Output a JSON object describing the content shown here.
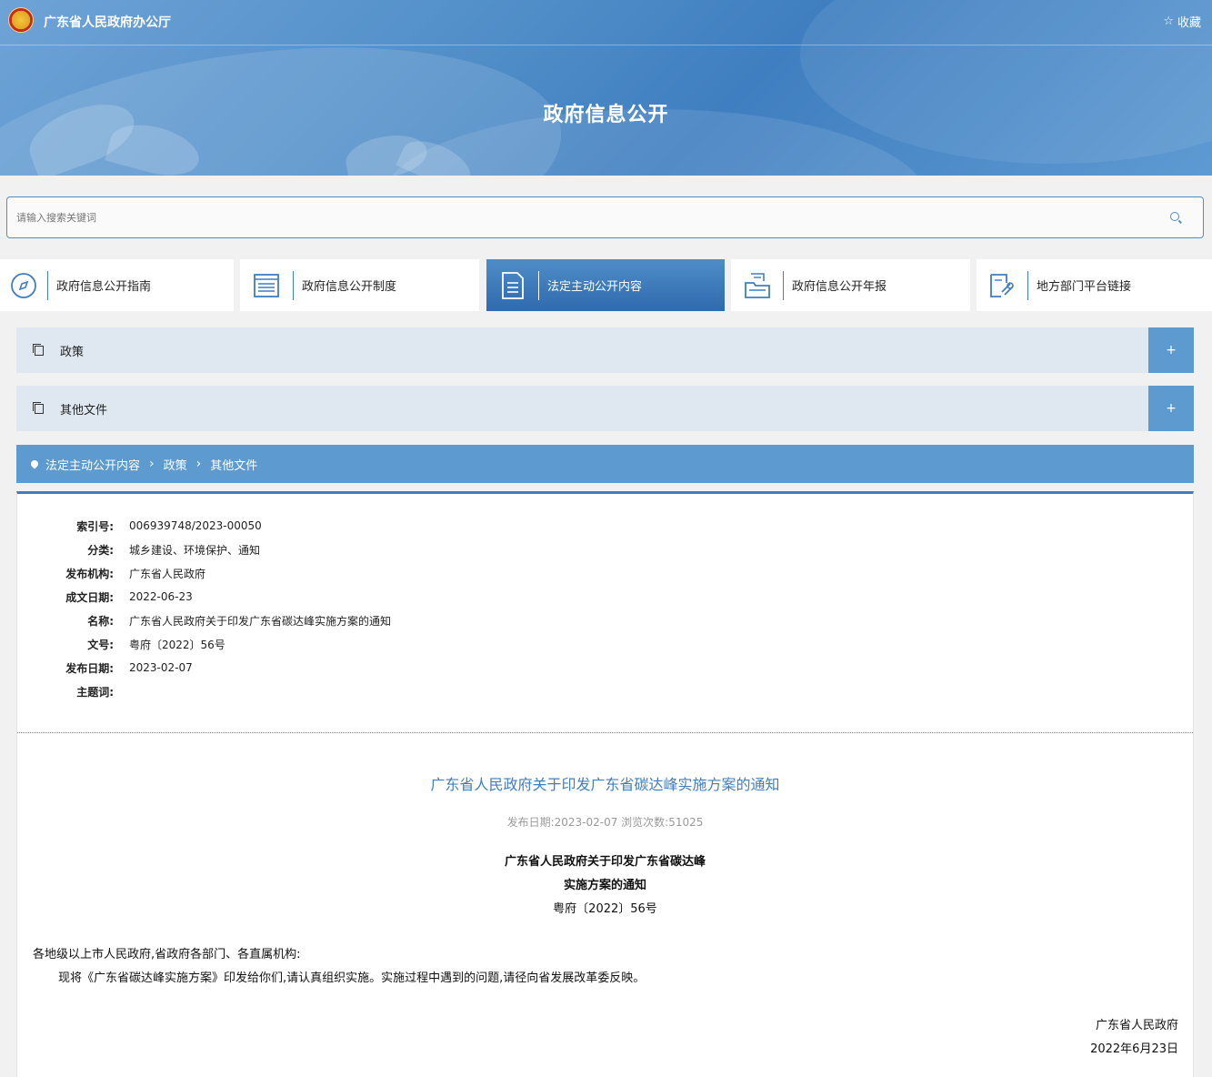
{
  "header": {
    "site_name": "广东省人民政府办公厅",
    "favorite_label": "收藏",
    "page_title": "政府信息公开"
  },
  "search": {
    "placeholder": "请输入搜索关键词"
  },
  "nav": [
    {
      "label": "政府信息公开指南",
      "icon": "compass-icon",
      "active": false
    },
    {
      "label": "政府信息公开制度",
      "icon": "list-doc-icon",
      "active": false
    },
    {
      "label": "法定主动公开内容",
      "icon": "document-icon",
      "active": true
    },
    {
      "label": "政府信息公开年报",
      "icon": "folder-doc-icon",
      "active": false
    },
    {
      "label": "地方部门平台链接",
      "icon": "link-doc-icon",
      "active": false
    }
  ],
  "accordions": [
    {
      "label": "政策",
      "toggle": "+"
    },
    {
      "label": "其他文件",
      "toggle": "+"
    }
  ],
  "breadcrumb": [
    "法定主动公开内容",
    "政策",
    "其他文件"
  ],
  "meta": [
    {
      "key": "索引号:",
      "value": "006939748/2023-00050"
    },
    {
      "key": "分类:",
      "value": "城乡建设、环境保护、通知"
    },
    {
      "key": "发布机构:",
      "value": "广东省人民政府"
    },
    {
      "key": "成文日期:",
      "value": "2022-06-23"
    },
    {
      "key": "名称:",
      "value": "广东省人民政府关于印发广东省碳达峰实施方案的通知"
    },
    {
      "key": "文号:",
      "value": "粤府〔2022〕56号"
    },
    {
      "key": "发布日期:",
      "value": "2023-02-07"
    },
    {
      "key": "主题词:",
      "value": ""
    }
  ],
  "article": {
    "title": "广东省人民政府关于印发广东省碳达峰实施方案的通知",
    "subline": "发布日期:2023-02-07  浏览次数:51025",
    "head_line1": "广东省人民政府关于印发广东省碳达峰",
    "head_line2": "实施方案的通知",
    "doc_number": "粤府〔2022〕56号",
    "salutation": "各地级以上市人民政府,省政府各部门、各直属机构:",
    "paragraph1": "现将《广东省碳达峰实施方案》印发给你们,请认真组织实施。实施过程中遇到的问题,请径向省发展改革委反映。",
    "signer": "广东省人民政府",
    "sign_date": "2022年6月23日"
  },
  "colors": {
    "primary": "#3f7ec0",
    "accent": "#5d9ad0",
    "accordion_bg": "#dfe8f0"
  }
}
